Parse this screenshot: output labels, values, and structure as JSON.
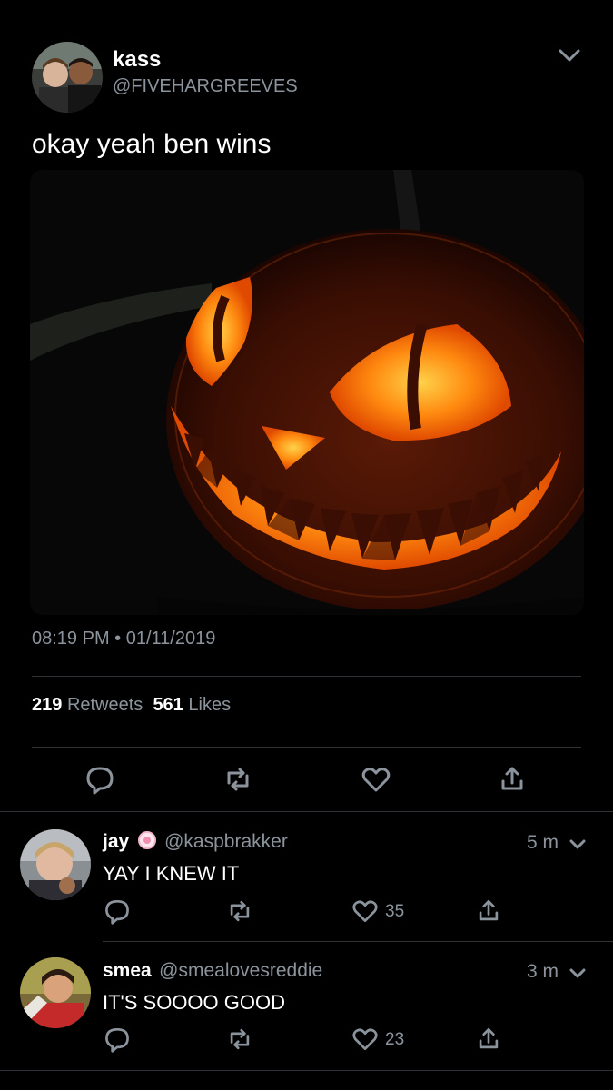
{
  "tweet": {
    "author_name": "kass",
    "author_handle": "@FIVEHARGREEVES",
    "text": "okay yeah ben wins",
    "timestamp": "08:19 PM • 01/11/2019",
    "retweets_count": "219",
    "retweets_label": "Retweets",
    "likes_count": "561",
    "likes_label": "Likes"
  },
  "replies": [
    {
      "name": "jay",
      "handle": "@kaspbrakker",
      "time": "5 m",
      "text": "YAY I KNEW IT",
      "likes": "35"
    },
    {
      "name": "smea",
      "handle": "@smealovesreddie",
      "time": "3 m",
      "text": "IT'S SOOOO GOOD",
      "likes": "23"
    }
  ],
  "colors": {
    "background": "#000000",
    "text_primary": "#ffffff",
    "text_secondary": "#8b949c",
    "divider": "#2f3336",
    "pumpkin_glow": "#ff8c1a"
  }
}
